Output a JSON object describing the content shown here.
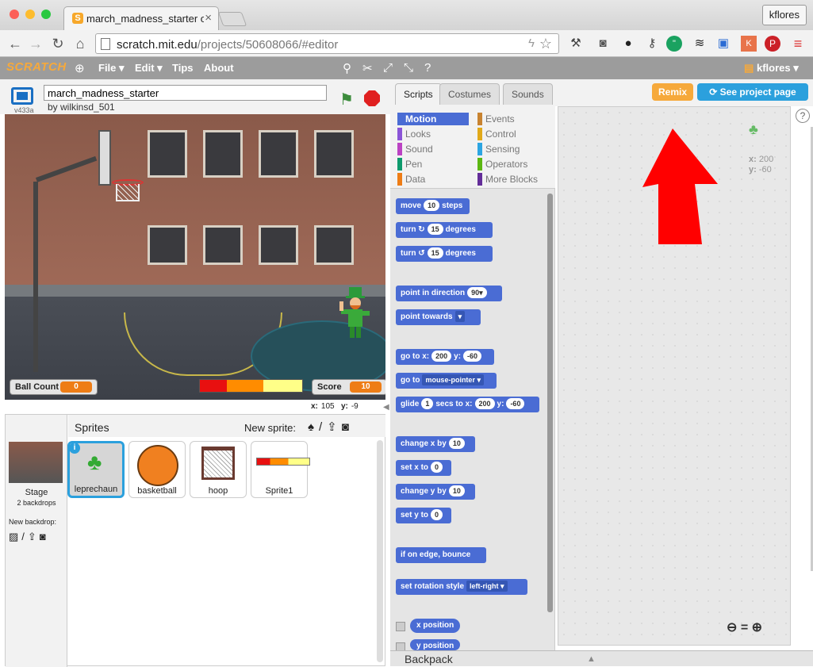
{
  "browser": {
    "tab_title": "march_madness_starter on",
    "tab_close": "×",
    "user_button": "kflores",
    "url_host": "scratch.mit.edu",
    "url_path": "/projects/50608066/#editor"
  },
  "menu": {
    "logo": "SCRATCH",
    "file": "File ▾",
    "edit": "Edit ▾",
    "tips": "Tips",
    "about": "About",
    "user": "kflores ▾"
  },
  "project": {
    "version": "v433a",
    "title": "march_madness_starter",
    "byline": "by wilkinsd_501"
  },
  "stage": {
    "ball_count_label": "Ball Count",
    "ball_count_value": "0",
    "score_label": "Score",
    "score_value": "10",
    "x_label": "x:",
    "x_value": "105",
    "y_label": "y:",
    "y_value": "-9",
    "bar_colors": [
      "#e81010",
      "#ff8c00",
      "#ffff88"
    ]
  },
  "sprites_pane": {
    "title": "Sprites",
    "new_sprite": "New sprite:",
    "stage_label": "Stage",
    "stage_backdrops": "2 backdrops",
    "new_backdrop": "New backdrop:",
    "sprites": [
      {
        "name": "leprechaun",
        "selected": true
      },
      {
        "name": "basketball",
        "selected": false
      },
      {
        "name": "hoop",
        "selected": false
      },
      {
        "name": "Sprite1",
        "selected": false
      }
    ]
  },
  "tabs": {
    "scripts": "Scripts",
    "costumes": "Costumes",
    "sounds": "Sounds",
    "remix": "Remix",
    "see_project": "See project page"
  },
  "categories": [
    {
      "label": "Motion",
      "color": "#4a6cd4"
    },
    {
      "label": "Looks",
      "color": "#8a55d7"
    },
    {
      "label": "Sound",
      "color": "#bb42c3"
    },
    {
      "label": "Pen",
      "color": "#0e9a6c"
    },
    {
      "label": "Data",
      "color": "#ee7d16"
    },
    {
      "label": "Events",
      "color": "#c88330"
    },
    {
      "label": "Control",
      "color": "#e1a91a"
    },
    {
      "label": "Sensing",
      "color": "#2ca5e2"
    },
    {
      "label": "Operators",
      "color": "#5cb712"
    },
    {
      "label": "More Blocks",
      "color": "#632d99"
    }
  ],
  "blocks": {
    "move": "move",
    "move_n": "10",
    "steps": "steps",
    "turn": "turn",
    "turn_r_n": "15",
    "degrees": "degrees",
    "turn_l_n": "15",
    "point_dir": "point in direction",
    "point_dir_n": "90▾",
    "point_towards": "point towards",
    "point_towards_dd": "▾",
    "goto_xy": "go to x:",
    "goto_x": "200",
    "goto_y_label": "y:",
    "goto_y": "-60",
    "goto": "go to",
    "goto_dd": "mouse-pointer ▾",
    "glide": "glide",
    "glide_n": "1",
    "glide_secs": "secs to x:",
    "glide_x": "200",
    "glide_y_label": "y:",
    "glide_y": "-60",
    "change_x": "change x by",
    "change_x_n": "10",
    "set_x": "set x to",
    "set_x_n": "0",
    "change_y": "change y by",
    "change_y_n": "10",
    "set_y": "set y to",
    "set_y_n": "0",
    "bounce": "if on edge, bounce",
    "rotation": "set rotation style",
    "rotation_dd": "left-right ▾",
    "x_position": "x position",
    "y_position": "y position"
  },
  "script_area": {
    "x_label": "x:",
    "x_value": "200",
    "y_label": "y:",
    "y_value": "-60"
  },
  "backpack": "Backpack"
}
